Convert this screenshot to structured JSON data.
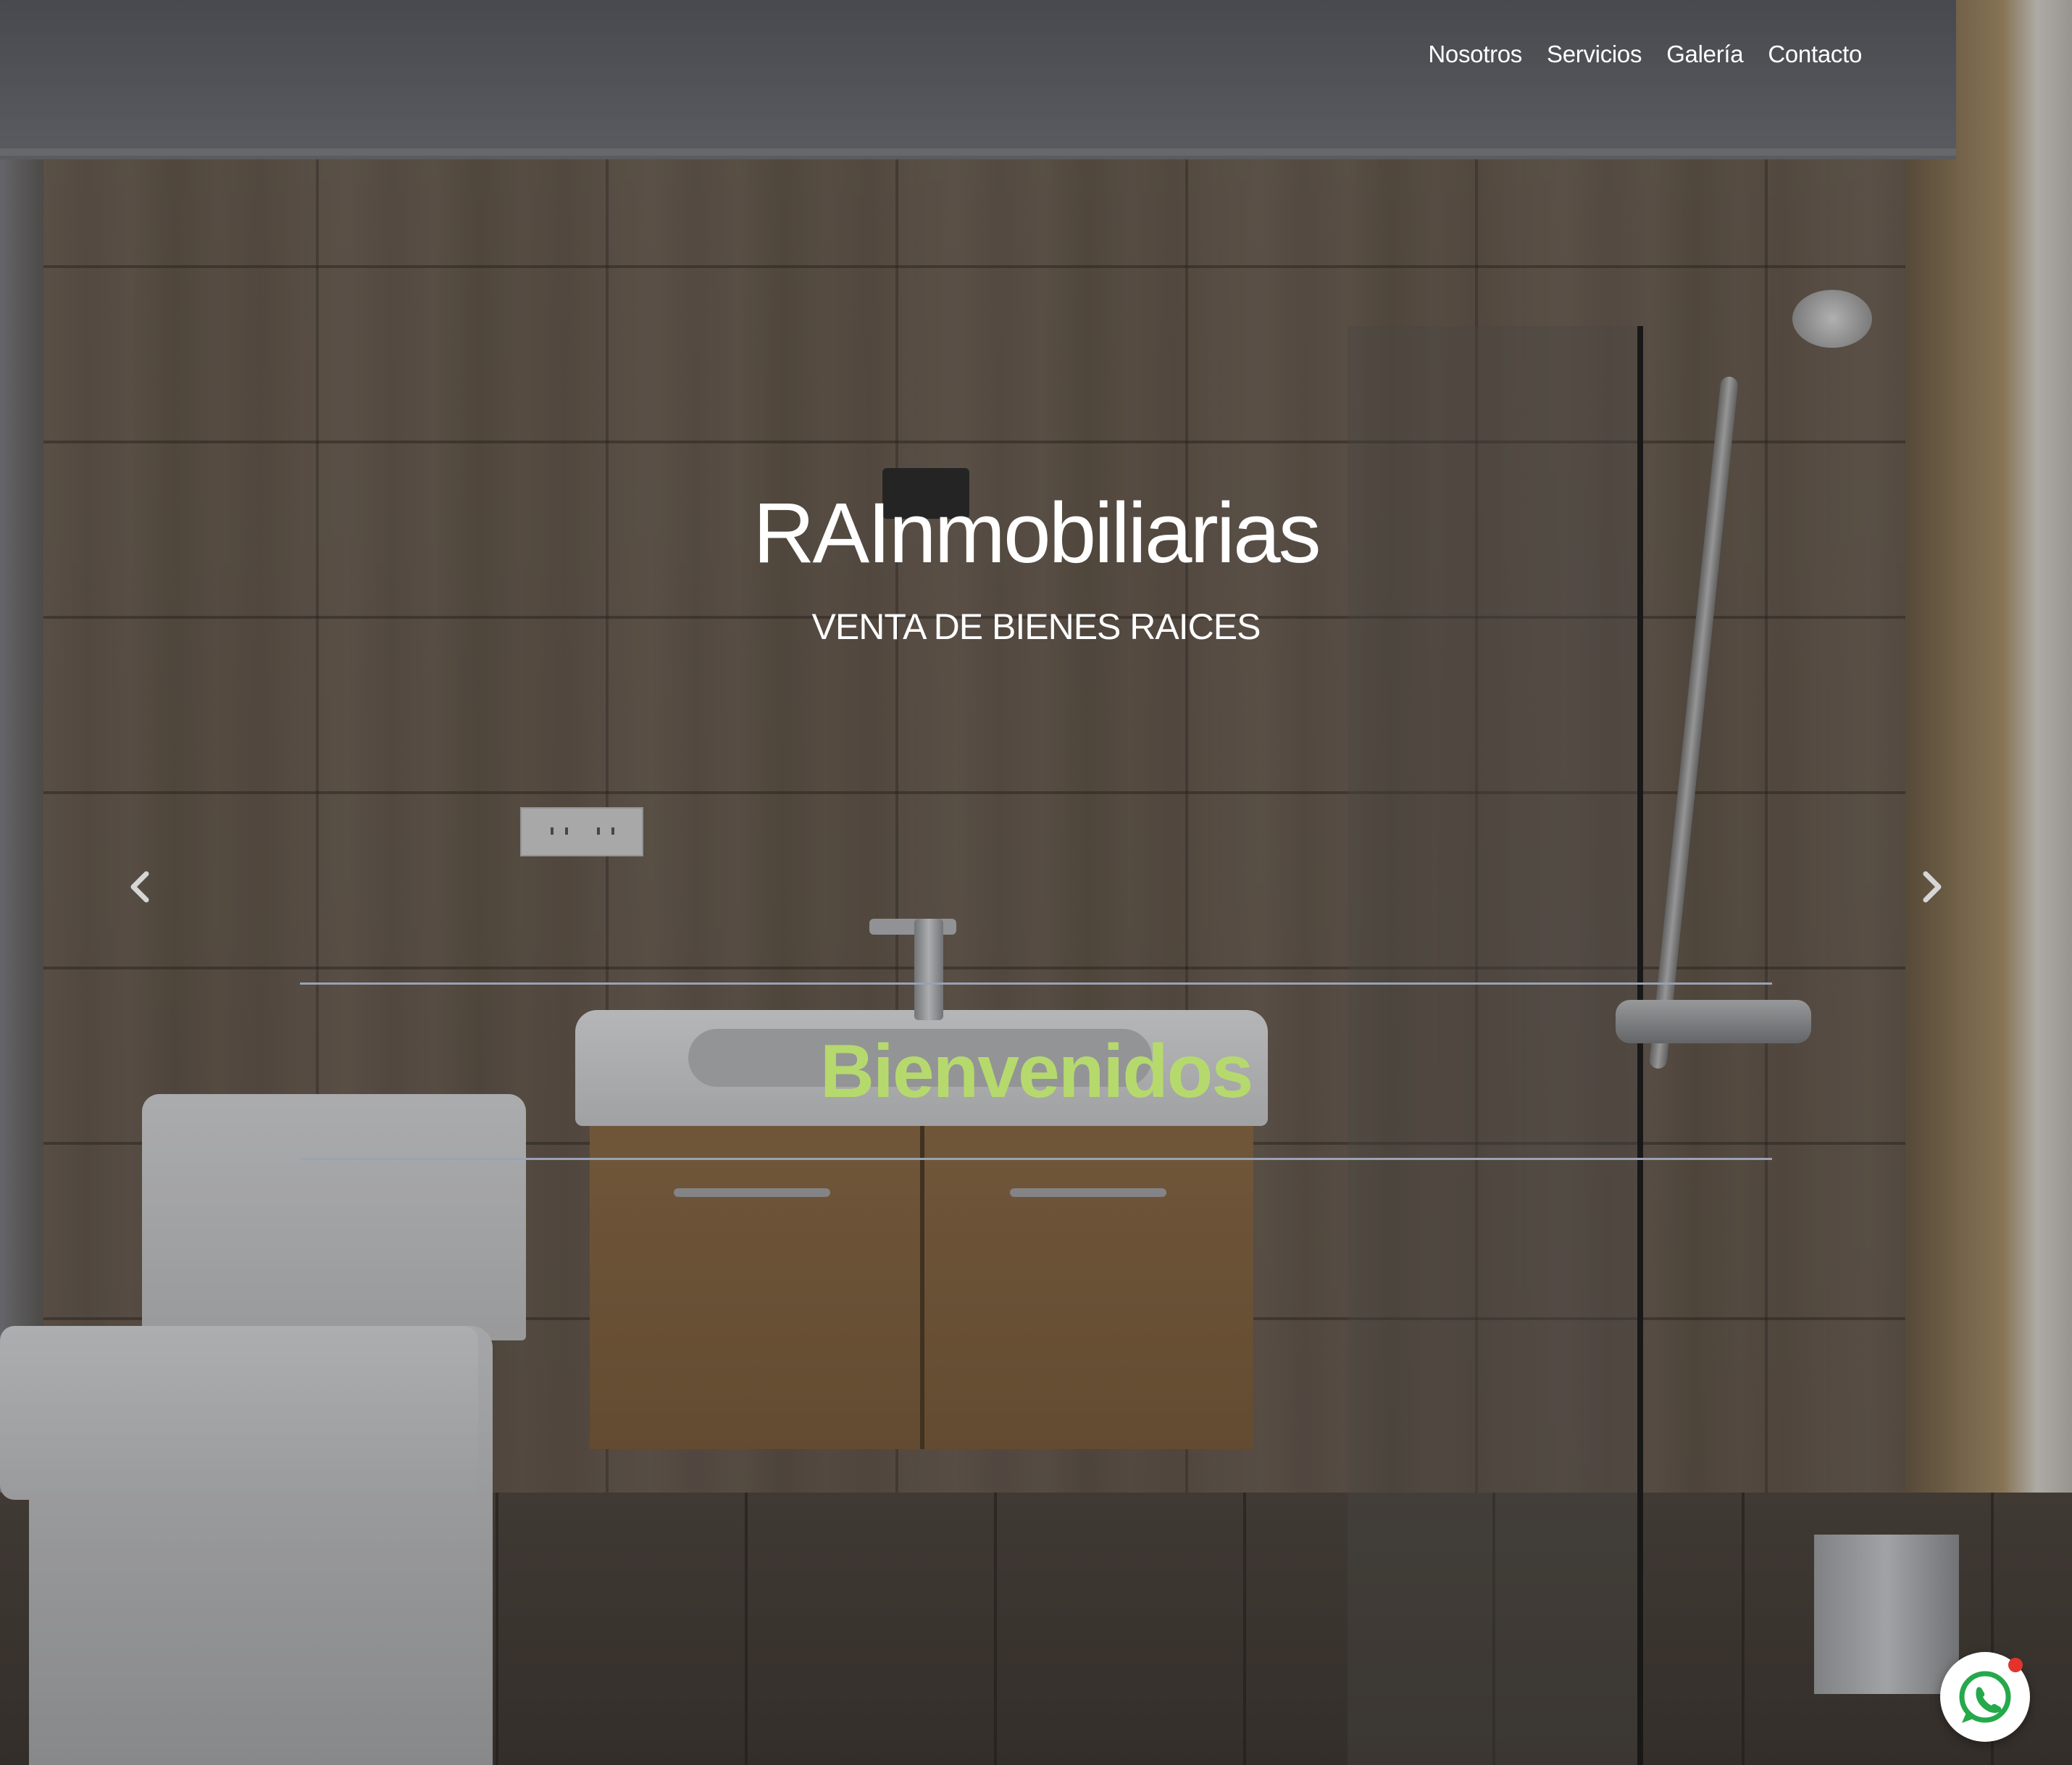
{
  "nav": {
    "items": [
      {
        "label": "Nosotros"
      },
      {
        "label": "Servicios"
      },
      {
        "label": "Galería"
      },
      {
        "label": "Contacto"
      }
    ]
  },
  "hero": {
    "title": "RAInmobiliarias",
    "subtitle": "VENTA DE BIENES RAICES",
    "welcome": "Bienvenidos"
  },
  "carousel": {
    "prev_icon": "chevron-left-icon",
    "next_icon": "chevron-right-icon"
  },
  "whatsapp": {
    "icon": "whatsapp-icon",
    "notification_color": "#e5322d"
  },
  "colors": {
    "accent": "#b6d96e",
    "text": "#ffffff",
    "rule": "#9aa2b3"
  }
}
